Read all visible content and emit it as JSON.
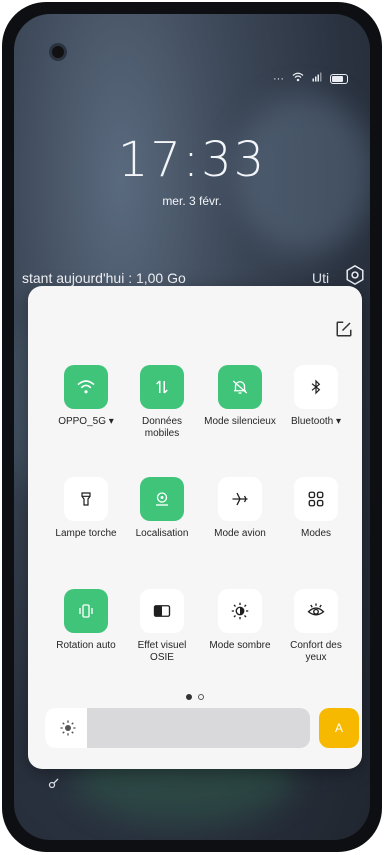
{
  "status_bar": {
    "signal_text": "···"
  },
  "lockscreen": {
    "time": "17:33",
    "date": "mer. 3 févr."
  },
  "data_usage": {
    "text": "stant aujourd'hui : 1,00 Go",
    "right_text": "Uti"
  },
  "quick_settings": {
    "tiles": [
      {
        "label": "OPPO_5G ▾",
        "icon": "wifi-icon",
        "state": "on"
      },
      {
        "label": "Données mobiles",
        "icon": "mobile-data-icon",
        "state": "on"
      },
      {
        "label": "Mode silencieux",
        "icon": "bell-off-icon",
        "state": "on"
      },
      {
        "label": "Bluetooth ▾",
        "icon": "bluetooth-icon",
        "state": "off"
      },
      {
        "label": "Lampe torche",
        "icon": "flashlight-icon",
        "state": "off"
      },
      {
        "label": "Localisation",
        "icon": "location-icon",
        "state": "on"
      },
      {
        "label": "Mode avion",
        "icon": "airplane-icon",
        "state": "off"
      },
      {
        "label": "Modes",
        "icon": "modes-grid-icon",
        "state": "off"
      },
      {
        "label": "Rotation auto",
        "icon": "rotation-icon",
        "state": "on"
      },
      {
        "label": "Effet visuel OSIE",
        "icon": "osie-icon",
        "state": "off"
      },
      {
        "label": "Mode sombre",
        "icon": "dark-mode-icon",
        "state": "off"
      },
      {
        "label": "Confort des yeux",
        "icon": "eye-comfort-icon",
        "state": "off"
      }
    ],
    "page_indicator": {
      "current": 1,
      "total": 2
    },
    "brightness": {
      "level": 0.16,
      "auto_label": "A"
    }
  },
  "colors": {
    "accent_green": "#3fc47a",
    "auto_yellow": "#f7b900"
  }
}
